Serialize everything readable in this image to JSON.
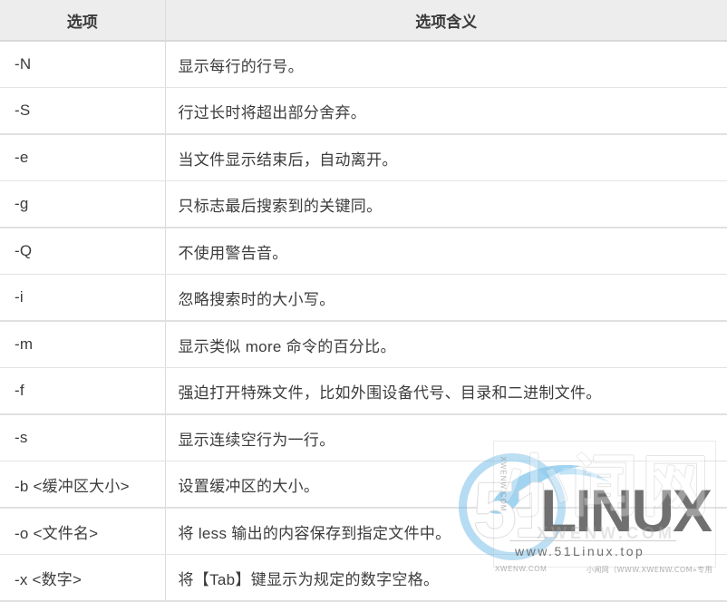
{
  "table": {
    "headers": {
      "option": "选项",
      "meaning": "选项含义"
    },
    "rows": [
      {
        "option": "-N",
        "meaning": "显示每行的行号。"
      },
      {
        "option": "-S",
        "meaning": "行过长时将超出部分舍弃。"
      },
      {
        "option": "-e",
        "meaning": "当文件显示结束后，自动离开。"
      },
      {
        "option": "-g",
        "meaning": "只标志最后搜索到的关键同。"
      },
      {
        "option": "-Q",
        "meaning": "不使用警告音。"
      },
      {
        "option": "-i",
        "meaning": "忽略搜索时的大小写。"
      },
      {
        "option": "-m",
        "meaning": "显示类似 more 命令的百分比。"
      },
      {
        "option": "-f",
        "meaning": "强迫打开特殊文件，比如外围设备代号、目录和二进制文件。"
      },
      {
        "option": "-s",
        "meaning": "显示连续空行为一行。"
      },
      {
        "option": "-b <缓冲区大小>",
        "meaning": "设置缓冲区的大小。"
      },
      {
        "option": "-o <文件名>",
        "meaning": "将 less 输出的内容保存到指定文件中。"
      },
      {
        "option": "-x <数字>",
        "meaning": "将【Tab】键显示为规定的数字空格。"
      }
    ]
  },
  "watermarks": {
    "linux_logo": {
      "number": "51",
      "word": "LINUX",
      "url": "www.51Linux.top"
    },
    "xwenw": {
      "cn_name": "小闻网",
      "en_name": "XWENW.COM",
      "side_text": "XWENW.COM",
      "bottom_left": "XWENW.COM",
      "bottom_right": "小闻网（WWW.XWENW.COM»专用"
    }
  },
  "colors": {
    "header_bg": "#ededed",
    "text": "#3c3c3c",
    "border": "#e3e3e3",
    "accent_blue": "#6fb9e8"
  }
}
